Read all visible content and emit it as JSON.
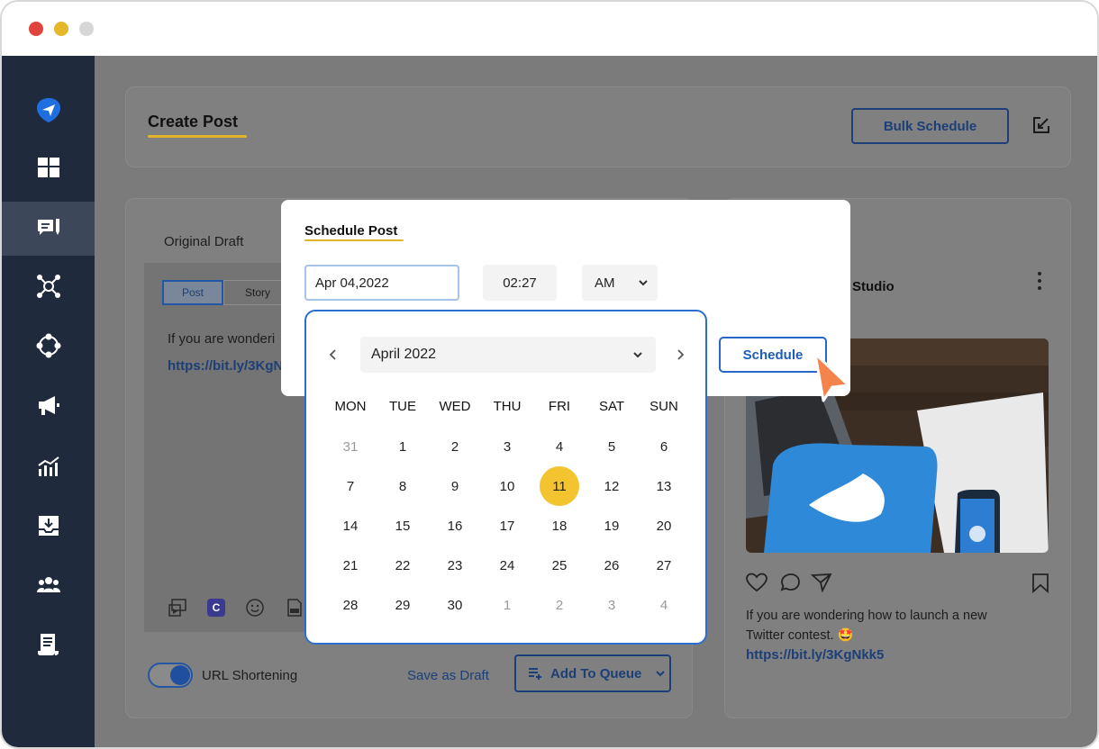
{
  "window": {
    "controls": [
      "close",
      "minimize",
      "maximize"
    ]
  },
  "sidebar": {
    "items": [
      {
        "icon": "paper-plane-logo-icon"
      },
      {
        "icon": "dashboard-icon"
      },
      {
        "icon": "posts-icon",
        "active": true
      },
      {
        "icon": "network-icon"
      },
      {
        "icon": "nodes-icon"
      },
      {
        "icon": "megaphone-icon"
      },
      {
        "icon": "analytics-icon"
      },
      {
        "icon": "inbox-icon"
      },
      {
        "icon": "team-icon"
      },
      {
        "icon": "document-icon"
      }
    ]
  },
  "header": {
    "title": "Create Post",
    "bulk_schedule": "Bulk Schedule"
  },
  "composer": {
    "tab_label": "Original Draft",
    "post_tab": "Post",
    "story_tab": "Story",
    "text": "If you are wonderi",
    "link": "https://bit.ly/3KgN",
    "url_shortening_label": "URL Shortening",
    "save_draft": "Save as Draft",
    "add_to_queue": "Add To Queue"
  },
  "preview": {
    "account_name": "Studio",
    "caption_line1": "If you are wondering how to launch a new",
    "caption_line2": "Twitter contest. 🤩",
    "link": "https://bit.ly/3KgNkk5"
  },
  "schedule_modal": {
    "title": "Schedule Post",
    "date_value": "Apr 04,2022",
    "time_value": "02:27",
    "ampm_value": "AM",
    "schedule_button": "Schedule"
  },
  "calendar": {
    "month_label": "April 2022",
    "weekdays": [
      "MON",
      "TUE",
      "WED",
      "THU",
      "FRI",
      "SAT",
      "SUN"
    ],
    "weeks": [
      [
        "31",
        "1",
        "2",
        "3",
        "4",
        "5",
        "6"
      ],
      [
        "7",
        "8",
        "9",
        "10",
        "11",
        "12",
        "13"
      ],
      [
        "14",
        "15",
        "16",
        "17",
        "18",
        "19",
        "20"
      ],
      [
        "21",
        "22",
        "23",
        "24",
        "25",
        "26",
        "27"
      ],
      [
        "28",
        "29",
        "30",
        "1",
        "2",
        "3",
        "4"
      ]
    ],
    "selected_day": "11",
    "accent_color": "#f4c430"
  }
}
